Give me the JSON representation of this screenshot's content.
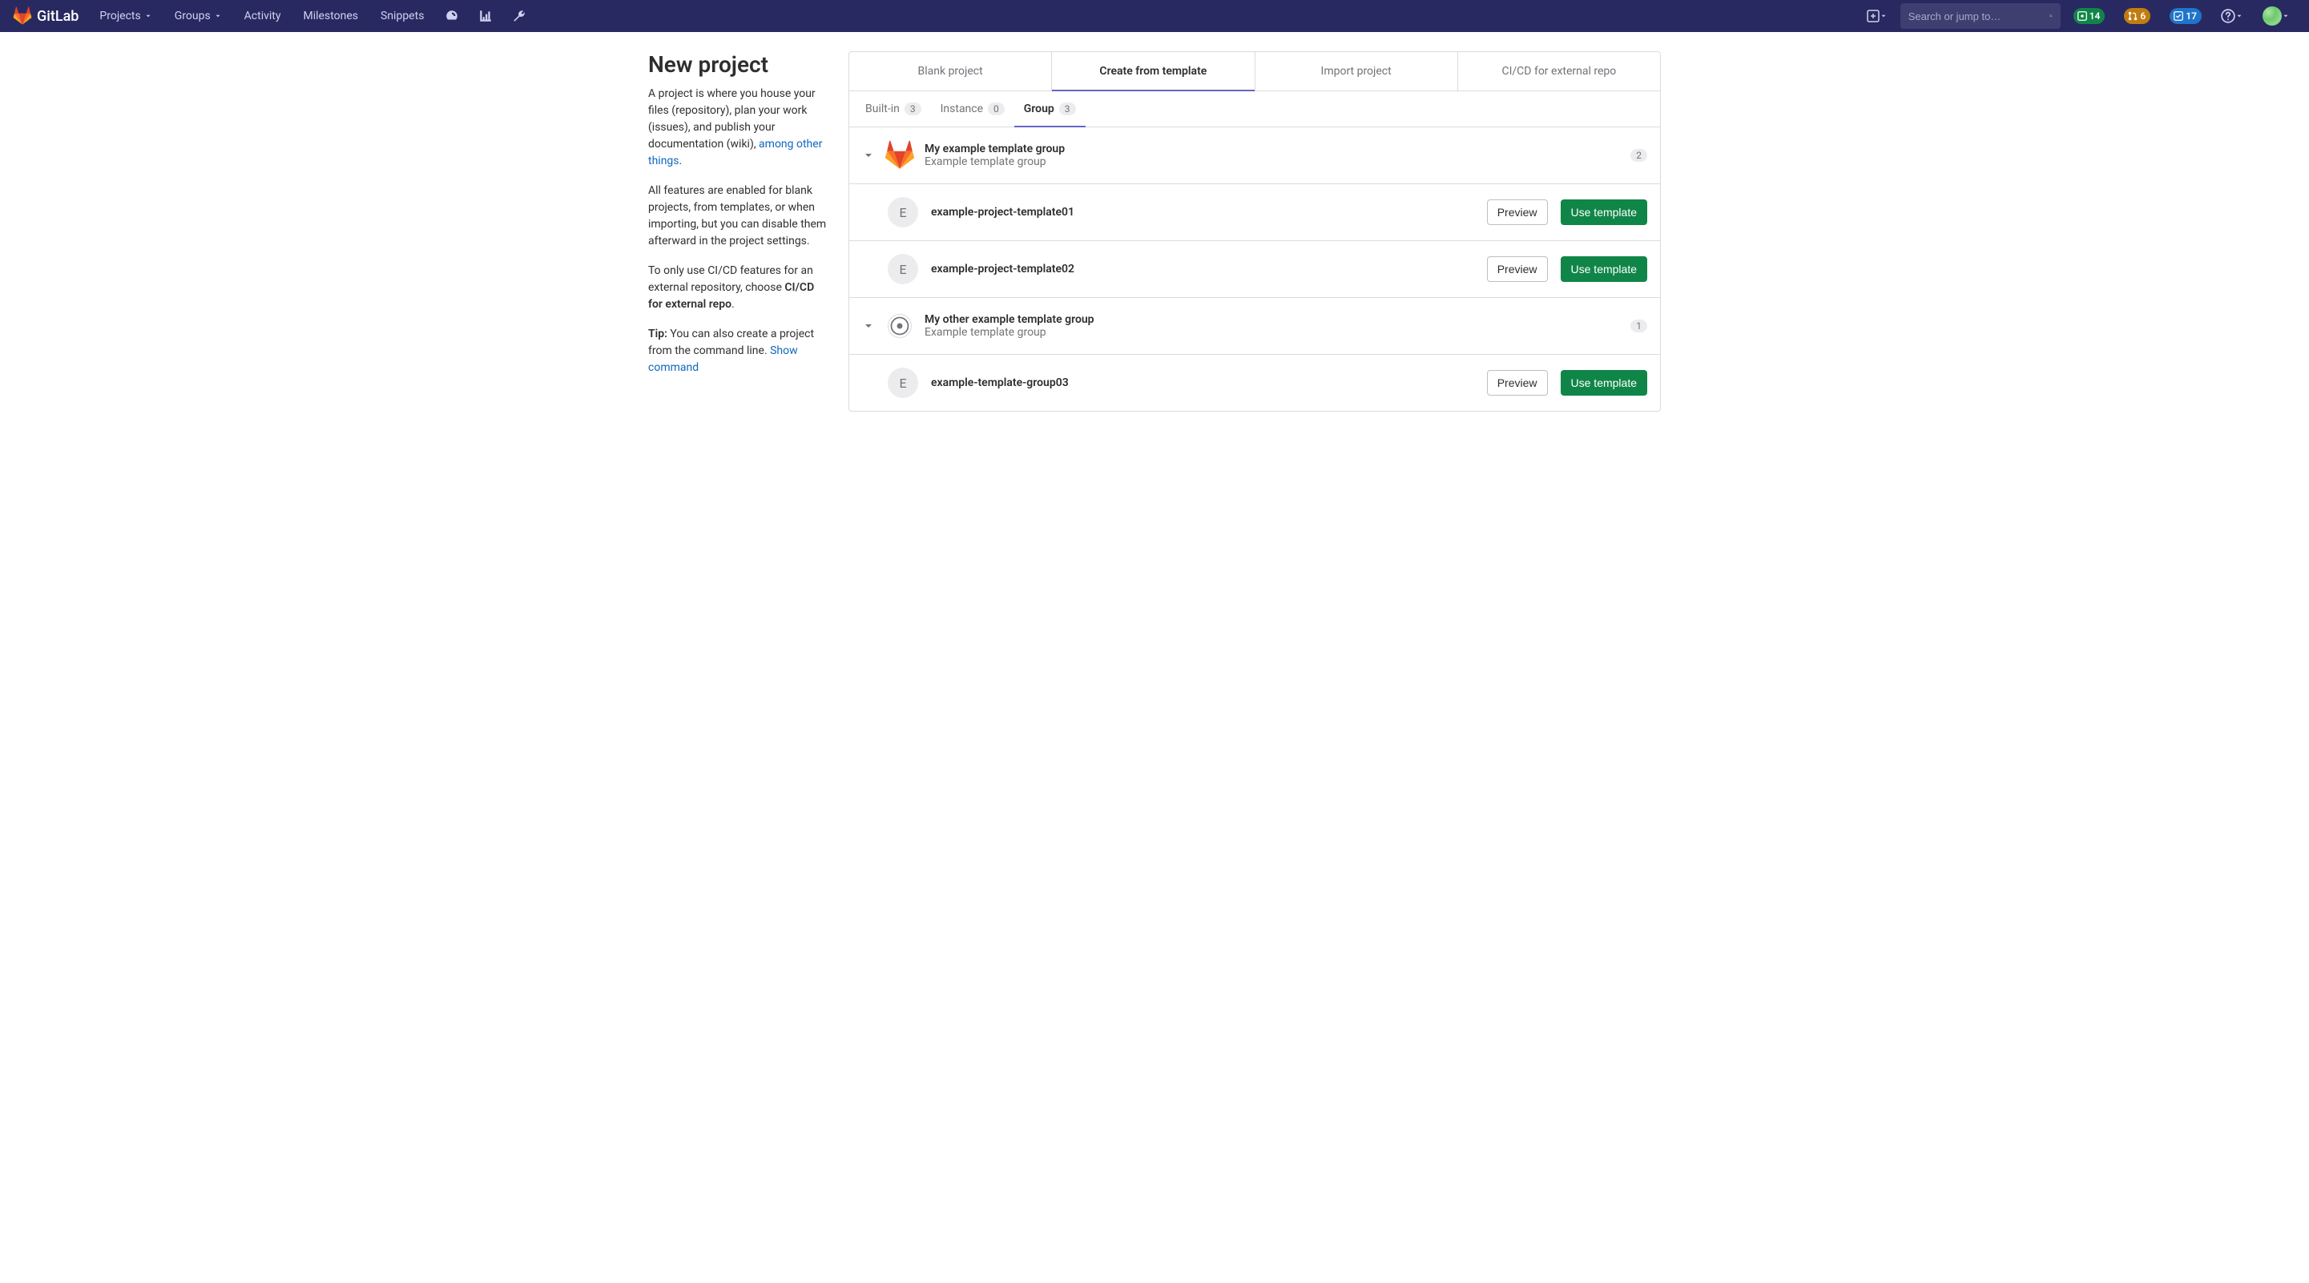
{
  "navbar": {
    "brand": "GitLab",
    "links": {
      "projects": "Projects",
      "groups": "Groups",
      "activity": "Activity",
      "milestones": "Milestones",
      "snippets": "Snippets"
    },
    "search_placeholder": "Search or jump to…",
    "counts": {
      "issues": "14",
      "mr": "6",
      "todo": "17"
    }
  },
  "sidebar": {
    "title": "New project",
    "p1a": "A project is where you house your files (repository), plan your work (issues), and publish your documentation (wiki), ",
    "p1link": "among other things",
    "p1b": ".",
    "p2": "All features are enabled for blank projects, from templates, or when importing, but you can disable them afterward in the project settings.",
    "p3a": "To only use CI/CD features for an external repository, choose ",
    "p3b": "CI/CD for external repo",
    "p3c": ".",
    "p4a": "Tip:",
    "p4b": " You can also create a project from the command line. ",
    "p4link": "Show command"
  },
  "main_tabs": {
    "blank": "Blank project",
    "template": "Create from template",
    "import": "Import project",
    "cicd": "CI/CD for external repo"
  },
  "sub_tabs": {
    "builtin_label": "Built-in",
    "builtin_count": "3",
    "instance_label": "Instance",
    "instance_count": "0",
    "group_label": "Group",
    "group_count": "3"
  },
  "groups": [
    {
      "title": "My example template group",
      "subtitle": "Example template group",
      "count": "2",
      "logo": "tanuki",
      "templates": [
        {
          "avatar": "E",
          "name": "example-project-template01"
        },
        {
          "avatar": "E",
          "name": "example-project-template02"
        }
      ]
    },
    {
      "title": "My other example template group",
      "subtitle": "Example template group",
      "count": "1",
      "logo": "circle",
      "templates": [
        {
          "avatar": "E",
          "name": "example-template-group03"
        }
      ]
    }
  ],
  "buttons": {
    "preview": "Preview",
    "use_template": "Use template"
  }
}
